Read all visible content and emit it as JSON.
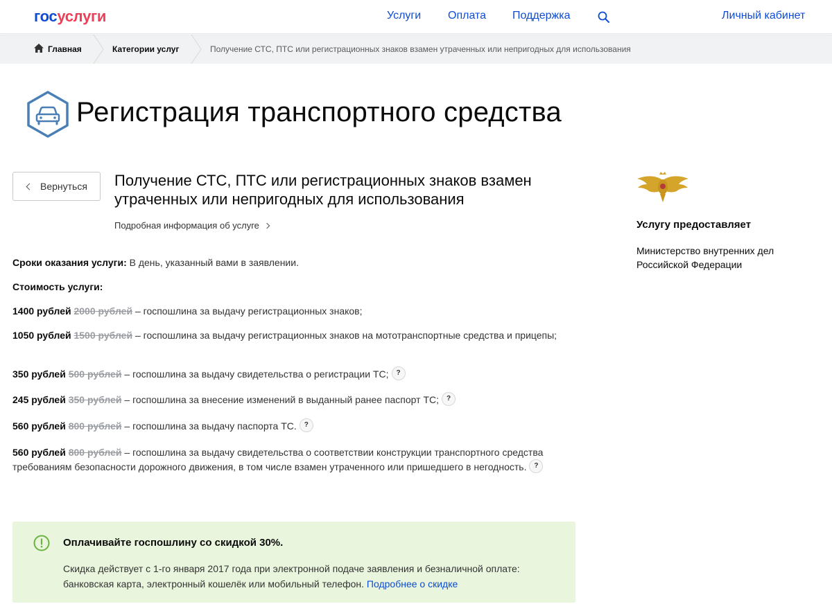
{
  "header": {
    "logo_gos": "гос",
    "logo_uslugi": "услуги",
    "nav": [
      "Услуги",
      "Оплата",
      "Поддержка"
    ],
    "account": "Личный кабинет",
    "search_icon": "search-icon"
  },
  "breadcrumbs": {
    "home": "Главная",
    "categories": "Категории услуг",
    "current": "Получение СТС, ПТС или регистрационных знаков взамен утраченных или непригодных для использования"
  },
  "page": {
    "title": "Регистрация транспортного средства",
    "back": "Вернуться",
    "service_title": "Получение СТС, ПТС или регистрационных знаков взамен утраченных или непригодных для использования",
    "more_info": "Подробная информация об услуге"
  },
  "terms": {
    "label": "Сроки оказания услуги:",
    "value": " В день, указанный вами в заявлении."
  },
  "cost_label": "Стоимость услуги:",
  "prices": [
    {
      "new": "1400 рублей",
      "old": "2000 рублей",
      "desc": " – госпошлина за выдачу регистрационных знаков;",
      "help": ""
    },
    {
      "new": "1050 рублей",
      "old": "1500 рублей",
      "desc": " – госпошлина за выдачу регистрационных знаков на мототранспортные средства и прицепы;",
      "help": ""
    },
    {
      "new": "350 рублей",
      "old": "500 рублей",
      "desc": " – госпошлина за выдачу свидетельства о регистрации ТС;",
      "help": "?"
    },
    {
      "new": "245 рублей",
      "old": "350 рублей",
      "desc": " – госпошлина за внесение изменений в выданный ранее паспорт ТС;",
      "help": "?"
    },
    {
      "new": "560 рублей",
      "old": "800 рублей",
      "desc": " – госпошлина за выдачу паспорта ТС.",
      "help": "?"
    },
    {
      "new": "560 рублей",
      "old": "800 рублей",
      "desc": " – госпошлина за выдачу свидетельства о соответствии конструкции транспортного средства требованиям безопасности дорожного движения, в том числе взамен утраченного или пришедшего в негодность.",
      "help": "?"
    }
  ],
  "sidebar": {
    "provider_label": "Услугу предоставляет",
    "provider_name": "Министерство внутренних дел Российской Федерации"
  },
  "discount": {
    "title": "Оплачивайте госпошлину со скидкой 30%.",
    "text": "Скидка действует с 1-го января 2017 года при электронной подаче заявления и безналичной оплате: банковская карта, электронный кошелёк или мобильный телефон. ",
    "link": "Подробнее о скидке"
  },
  "colors": {
    "brand_blue": "#0d4cd3",
    "brand_red": "#ee3f58",
    "discount_bg": "#e9f5dc",
    "icon_blue": "#4a7fb5",
    "success_green": "#6cb33f"
  }
}
